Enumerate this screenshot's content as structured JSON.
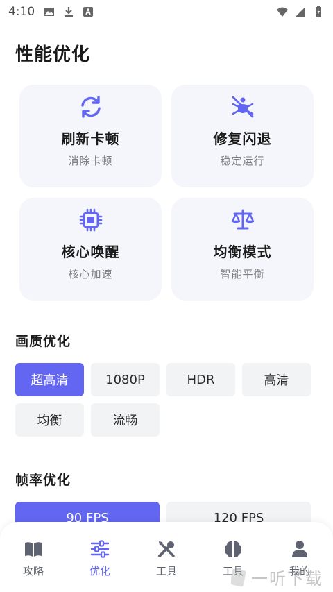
{
  "status_bar": {
    "time": "4:10"
  },
  "page": {
    "title": "性能优化"
  },
  "cards": [
    {
      "title": "刷新卡顿",
      "subtitle": "消除卡顿"
    },
    {
      "title": "修复闪退",
      "subtitle": "稳定运行"
    },
    {
      "title": "核心唤醒",
      "subtitle": "核心加速"
    },
    {
      "title": "均衡模式",
      "subtitle": "智能平衡"
    }
  ],
  "quality": {
    "title": "画质优化",
    "options": [
      "超高清",
      "1080P",
      "HDR",
      "高清",
      "均衡",
      "流畅"
    ],
    "selected": "超高清"
  },
  "framerate": {
    "title": "帧率优化",
    "options": [
      "90 FPS",
      "120 FPS"
    ],
    "selected": "90 FPS"
  },
  "bottom_nav": {
    "items": [
      "攻略",
      "优化",
      "工具",
      "工具",
      "我的"
    ],
    "active": "优化"
  },
  "watermark": "一听下载",
  "colors": {
    "accent": "#6366f1",
    "card_bg": "#f5f6fb",
    "chip_bg": "#f2f3f5"
  }
}
